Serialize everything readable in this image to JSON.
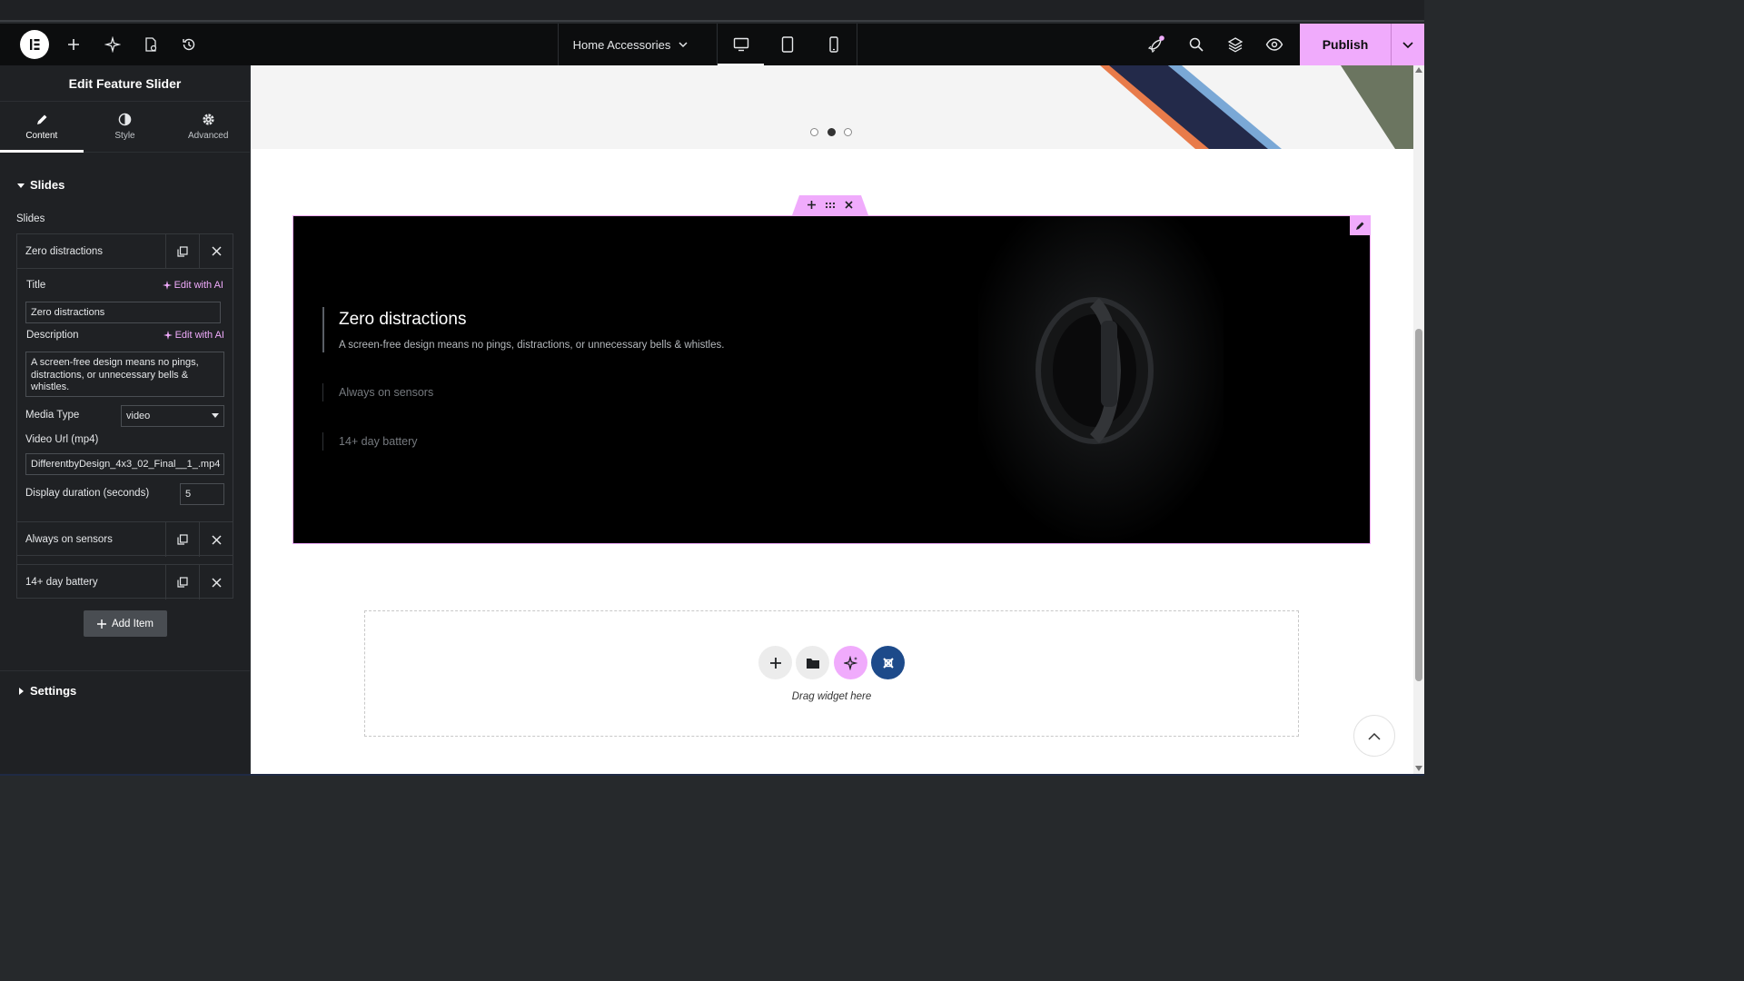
{
  "app": {
    "page_name": "Home Accessories",
    "publish_label": "Publish"
  },
  "colors": {
    "accent": "#f0abfc",
    "dark_panel": "#1f2124",
    "toolbar": "#0c0d0e",
    "navy": "#1d4a8a"
  },
  "sidebar": {
    "title": "Edit Feature Slider",
    "tabs": [
      {
        "label": "Content",
        "icon": "pencil-icon"
      },
      {
        "label": "Style",
        "icon": "half-circle-icon"
      },
      {
        "label": "Advanced",
        "icon": "gear-icon"
      }
    ],
    "slides_section": "Slides",
    "slides_label": "Slides",
    "items": [
      {
        "label": "Zero distractions"
      },
      {
        "label": "Always on sensors"
      },
      {
        "label": "14+ day battery"
      }
    ],
    "form": {
      "title_label": "Title",
      "edit_ai": "Edit with AI",
      "title_value": "Zero distractions",
      "description_label": "Description",
      "description_value": "A screen-free design means no pings, distractions, or unnecessary bells & whistles.",
      "media_type_label": "Media Type",
      "media_type_value": "video",
      "video_url_label": "Video Url (mp4)",
      "video_url_value": "DifferentbyDesign_4x3_02_Final__1_.mp4",
      "duration_label": "Display duration (seconds)",
      "duration_value": "5"
    },
    "add_item": "Add Item",
    "settings_section": "Settings"
  },
  "canvas": {
    "slider": {
      "active_title": "Zero distractions",
      "active_description": "A screen-free design means no pings, distractions, or unnecessary bells & whistles.",
      "other_items": [
        "Always on sensors",
        "14+ day battery"
      ]
    },
    "drop_zone": {
      "label": "Drag widget here"
    }
  }
}
